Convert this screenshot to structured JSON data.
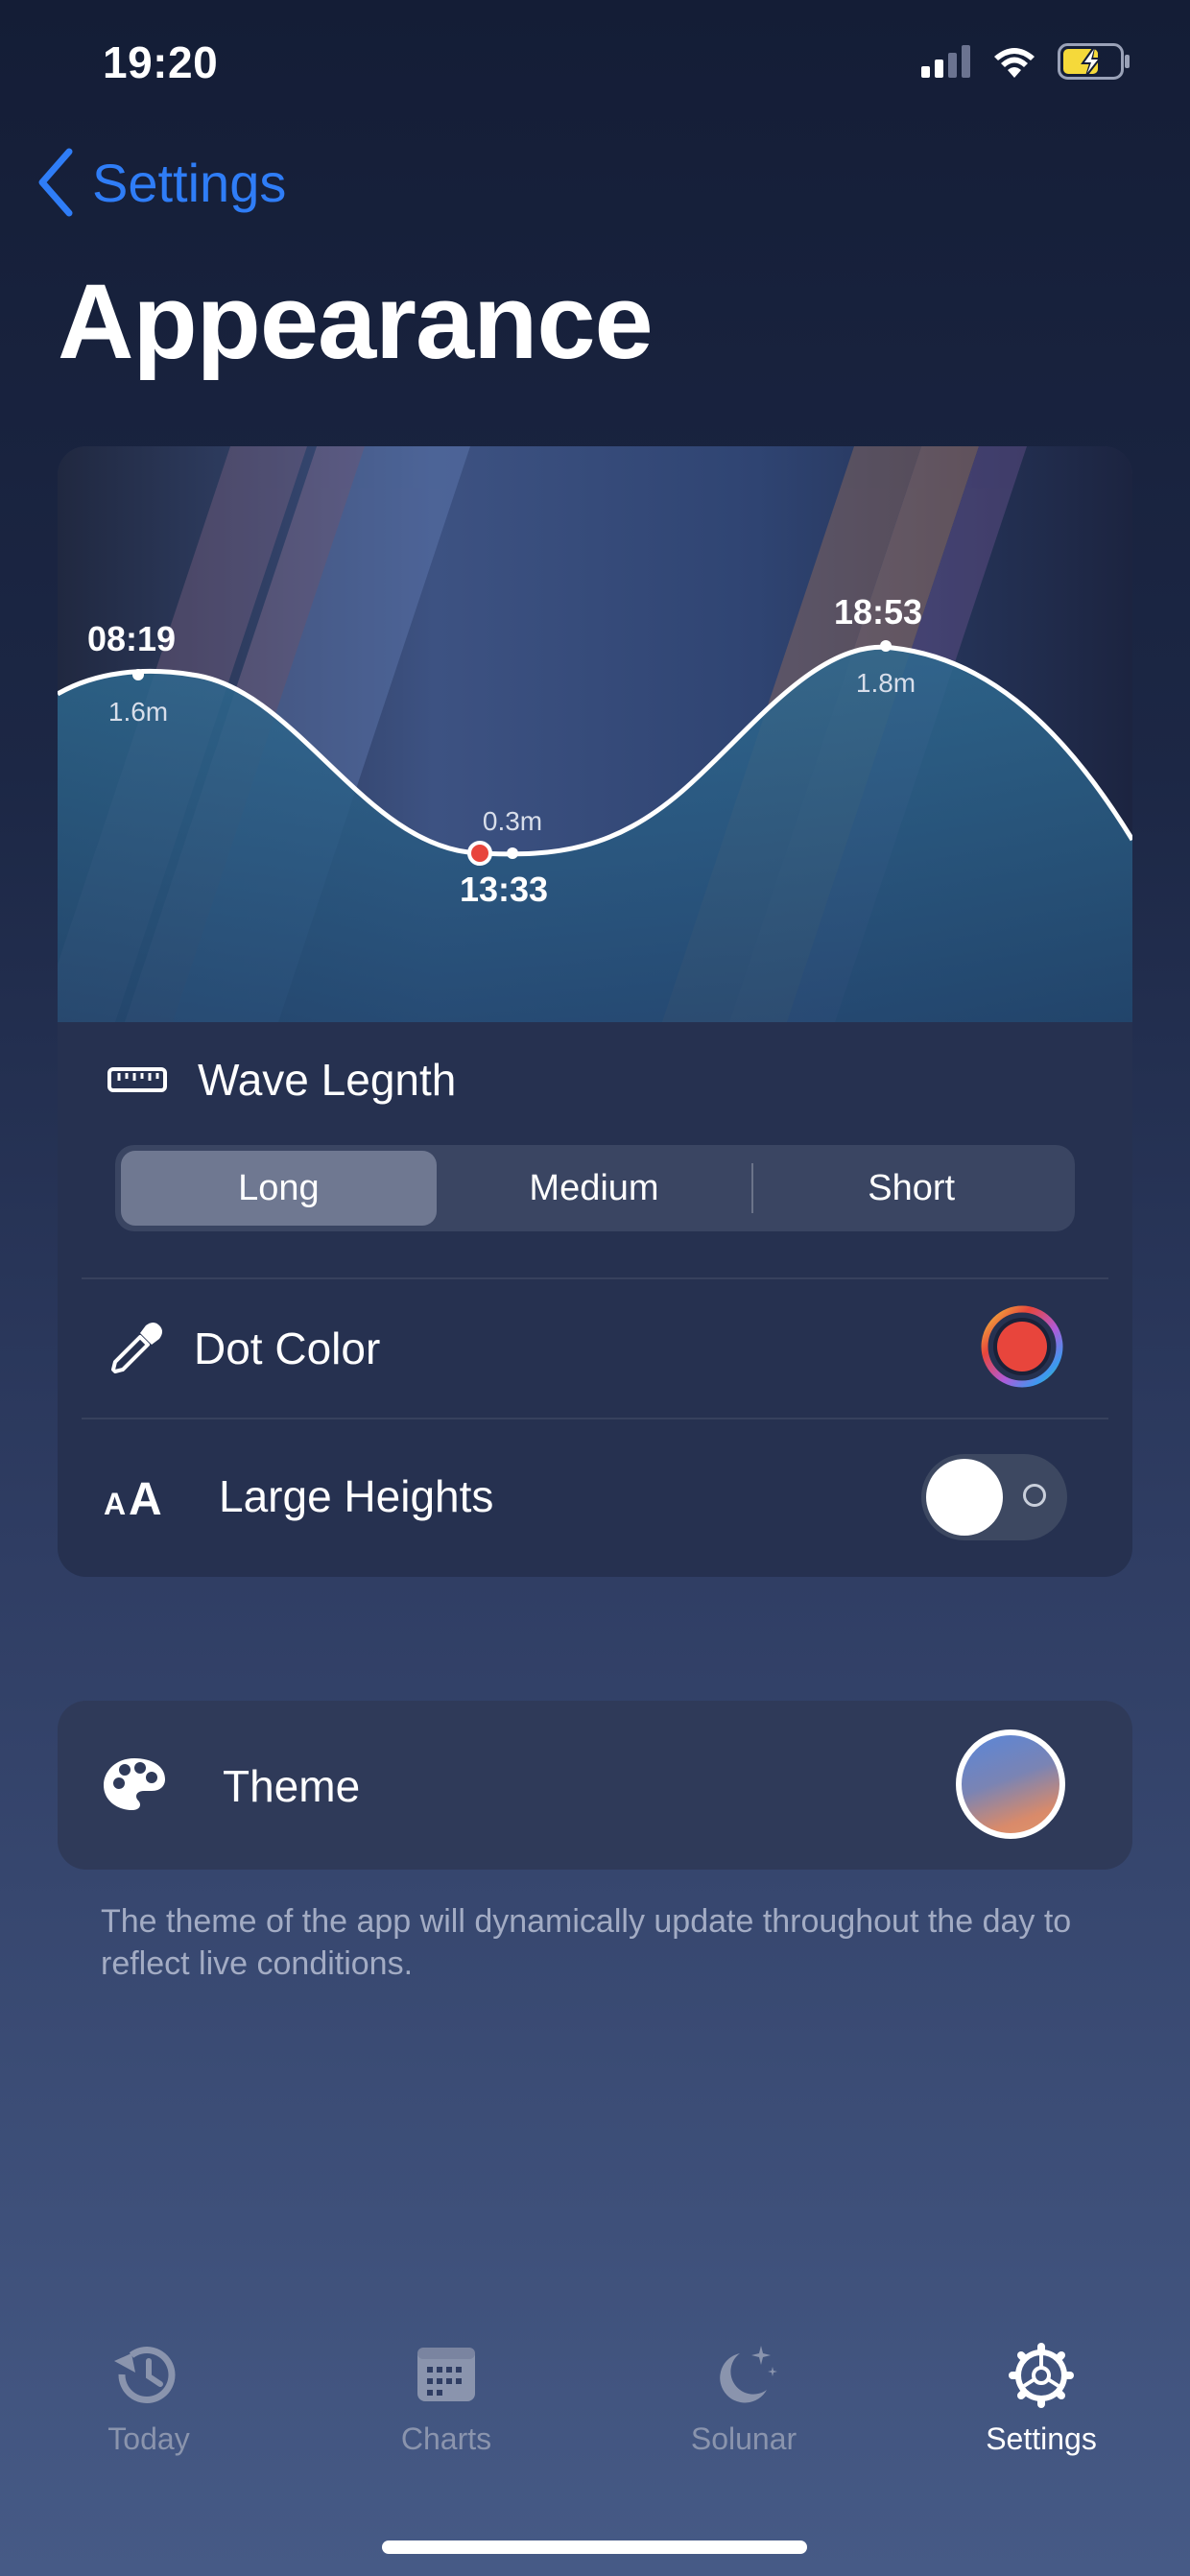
{
  "status_bar": {
    "time": "19:20"
  },
  "nav": {
    "back_label": "Settings",
    "title": "Appearance"
  },
  "tide_preview": {
    "points": [
      {
        "time": "08:19",
        "height": "1.6m",
        "type": "high"
      },
      {
        "time": "13:33",
        "height": "0.3m",
        "type": "low"
      },
      {
        "time": "18:53",
        "height": "1.8m",
        "type": "high"
      }
    ],
    "dot_color": "#e8453c"
  },
  "wave_length": {
    "label": "Wave Legnth",
    "options": [
      "Long",
      "Medium",
      "Short"
    ],
    "selected": "Long"
  },
  "dot_color": {
    "label": "Dot Color",
    "value": "#e8453c"
  },
  "large_heights": {
    "label": "Large Heights",
    "enabled": false
  },
  "theme": {
    "label": "Theme",
    "footnote": "The theme of the app will dynamically update throughout the day to reflect live conditions."
  },
  "tabbar": {
    "tabs": [
      {
        "label": "Today",
        "icon": "clock-history-icon"
      },
      {
        "label": "Charts",
        "icon": "calendar-icon"
      },
      {
        "label": "Solunar",
        "icon": "moon-stars-icon"
      },
      {
        "label": "Settings",
        "icon": "gear-icon"
      }
    ],
    "selected": "Settings"
  },
  "colors": {
    "accent": "#2f7df7",
    "card": "#263150"
  }
}
